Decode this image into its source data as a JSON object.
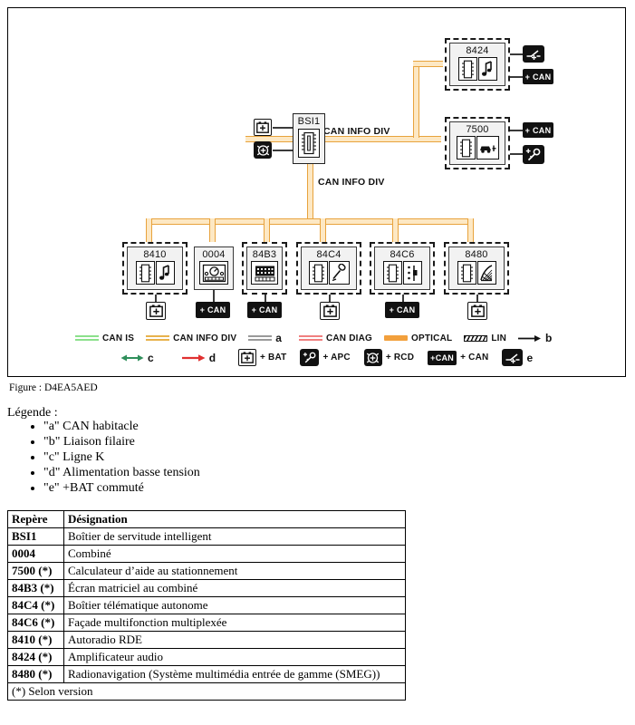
{
  "figure": {
    "caption": "Figure : D4EA5AED",
    "bus_labels": {
      "top": "CAN INFO DIV",
      "bottom": "CAN INFO DIV"
    },
    "central_node": {
      "label": "BSI1",
      "icon": "ecu-chip-icon",
      "attachments": [
        {
          "name": "plus-bat-badge",
          "symbol": "+",
          "type": "white"
        },
        {
          "name": "plus-rcd-badge",
          "symbol": "+",
          "type": "dark"
        }
      ]
    },
    "right_modules": [
      {
        "label": "8424",
        "dashed": true,
        "icons": [
          "chip-icon",
          "music-note-icon"
        ],
        "attachments": [
          {
            "name": "plus-bat-commute-badge",
            "label": "",
            "type": "dark-switch"
          },
          {
            "name": "plus-can-badge",
            "label": "+ CAN",
            "type": "black"
          }
        ]
      },
      {
        "label": "7500",
        "dashed": true,
        "icons": [
          "chip-icon",
          "car-parking-sensor-icon"
        ],
        "attachments": [
          {
            "name": "plus-can-badge",
            "label": "+ CAN",
            "type": "black"
          },
          {
            "name": "plus-apc-badge",
            "label": "",
            "type": "dark-key"
          }
        ]
      }
    ],
    "bottom_modules": [
      {
        "label": "8410",
        "dashed": true,
        "icons": [
          "chip-icon",
          "music-note-icon"
        ],
        "power": {
          "label": "+",
          "type": "white"
        }
      },
      {
        "label": "0004",
        "dashed": false,
        "icons": [
          "instrument-cluster-icon"
        ],
        "power": {
          "label": "+ CAN",
          "type": "black"
        }
      },
      {
        "label": "84B3",
        "dashed": true,
        "icons": [
          "matrix-display-icon"
        ],
        "power": {
          "label": "+ CAN",
          "type": "black"
        }
      },
      {
        "label": "84C4",
        "dashed": true,
        "icons": [
          "chip-icon",
          "microphone-icon"
        ],
        "power": {
          "label": "+",
          "type": "white"
        }
      },
      {
        "label": "84C6",
        "dashed": true,
        "icons": [
          "chip-icon",
          "faceplate-icon"
        ],
        "power": {
          "label": "+ CAN",
          "type": "black"
        }
      },
      {
        "label": "8480",
        "dashed": true,
        "icons": [
          "chip-icon",
          "navigation-map-icon"
        ],
        "power": {
          "label": "+",
          "type": "white"
        }
      }
    ],
    "legend_row1": [
      {
        "symbol": "double-line",
        "color": "#8ce08c",
        "label": "CAN IS"
      },
      {
        "symbol": "double-line",
        "color": "#e8b24d",
        "label": "CAN INFO DIV"
      },
      {
        "symbol": "double-line",
        "color": "#9a9a9a",
        "label": "a"
      },
      {
        "symbol": "double-line",
        "color": "#f08080",
        "label": "CAN DIAG"
      },
      {
        "symbol": "solid-bar",
        "color": "#f2a03c",
        "label": "OPTICAL"
      },
      {
        "symbol": "hatched-bar",
        "color": "#111111",
        "label": "LIN"
      },
      {
        "symbol": "arrow-right",
        "color": "#111111",
        "label": "b"
      }
    ],
    "legend_row2": [
      {
        "symbol": "double-arrow",
        "color": "#2f8f5b",
        "label": "c"
      },
      {
        "symbol": "arrow-right",
        "color": "#e03030",
        "label": "d"
      },
      {
        "symbol": "badge-white-plus",
        "label": "+ BAT"
      },
      {
        "symbol": "badge-dark-key",
        "label": "+ APC"
      },
      {
        "symbol": "badge-dark-rcd",
        "label": "+ RCD"
      },
      {
        "symbol": "badge-black-can",
        "badge_text": "+CAN",
        "label": "+ CAN"
      },
      {
        "symbol": "badge-dark-switch",
        "label": "e"
      }
    ]
  },
  "legende": {
    "title": "Légende :",
    "items": [
      "\"a\" CAN habitacle",
      "\"b\" Liaison filaire",
      "\"c\" Ligne K",
      "\"d\" Alimentation basse tension",
      "\"e\" +BAT commuté"
    ]
  },
  "table": {
    "headers": [
      "Repère",
      "Désignation"
    ],
    "rows": [
      [
        "BSI1",
        "Boîtier de servitude intelligent"
      ],
      [
        "0004",
        "Combiné"
      ],
      [
        "7500 (*)",
        "Calculateur d’aide au stationnement"
      ],
      [
        "84B3 (*)",
        "Écran matriciel au combiné"
      ],
      [
        "84C4 (*)",
        "Boîtier télématique autonome"
      ],
      [
        "84C6 (*)",
        "Façade multifonction multiplexée"
      ],
      [
        "8410 (*)",
        "Autoradio RDE"
      ],
      [
        "8424 (*)",
        "Amplificateur audio"
      ],
      [
        "8480 (*)",
        "Radionavigation (Système multimédia entrée de gamme (SMEG))"
      ]
    ],
    "footer": "(*) Selon version"
  }
}
